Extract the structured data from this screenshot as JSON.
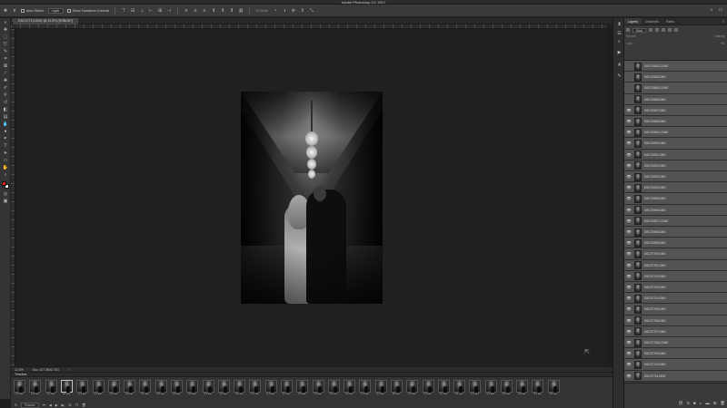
{
  "app": {
    "title": "Adobe Photoshop CC 2017"
  },
  "options_bar": {
    "auto_select_label": "Auto-Select:",
    "auto_select_value": "Layer",
    "transform_label": "Show Transform Controls",
    "mode_3d_label": "3D Mode:"
  },
  "document": {
    "tab_label": "DSC07713.DNG @ 12.5% (RGB/16*)",
    "close_glyph": "×"
  },
  "status": {
    "zoom": "12.5%",
    "doc_info": "Doc: 137.3M/2.74G"
  },
  "timeline": {
    "title": "Timeline",
    "loop": "Forever",
    "frames": [
      {
        "num": "1",
        "delay": "0.1 sec."
      },
      {
        "num": "2",
        "delay": "0.1 sec."
      },
      {
        "num": "3",
        "delay": "0.1 sec."
      },
      {
        "num": "4",
        "delay": "0.1 sec."
      },
      {
        "num": "5",
        "delay": "0.1 sec."
      },
      {
        "num": "6",
        "delay": "0.1 sec."
      },
      {
        "num": "7",
        "delay": "0.1 sec."
      },
      {
        "num": "8",
        "delay": "0.1 sec."
      },
      {
        "num": "9",
        "delay": "0.1 sec."
      },
      {
        "num": "10",
        "delay": "0.1 sec."
      },
      {
        "num": "11",
        "delay": "0.1 sec."
      },
      {
        "num": "12",
        "delay": "0.1 sec."
      },
      {
        "num": "13",
        "delay": "0.1 sec."
      },
      {
        "num": "14",
        "delay": "0.1 sec."
      },
      {
        "num": "15",
        "delay": "0.1 sec."
      },
      {
        "num": "16",
        "delay": "0.1 sec."
      },
      {
        "num": "17",
        "delay": "0.1 sec."
      },
      {
        "num": "18",
        "delay": "0.1 sec."
      },
      {
        "num": "19",
        "delay": "0.1 sec."
      },
      {
        "num": "20",
        "delay": "0.1 sec."
      },
      {
        "num": "21",
        "delay": "0.1 sec."
      },
      {
        "num": "22",
        "delay": "0.1 sec."
      },
      {
        "num": "23",
        "delay": "0.1 sec."
      },
      {
        "num": "24",
        "delay": "0.1 sec."
      },
      {
        "num": "25",
        "delay": "0.1 sec."
      },
      {
        "num": "26",
        "delay": "0.1 sec."
      },
      {
        "num": "27",
        "delay": "0.1 sec."
      },
      {
        "num": "28",
        "delay": "0.1 sec."
      },
      {
        "num": "29",
        "delay": "0.1 sec."
      },
      {
        "num": "30",
        "delay": "0.1 sec."
      },
      {
        "num": "31",
        "delay": "0.1 sec."
      },
      {
        "num": "32",
        "delay": "0.1 sec."
      },
      {
        "num": "33",
        "delay": "0.1 sec."
      },
      {
        "num": "34",
        "delay": "0.1 sec."
      },
      {
        "num": "35",
        "delay": "0.1 sec."
      }
    ]
  },
  "layers_panel": {
    "tabs": [
      "Layers",
      "Channels",
      "Paths"
    ],
    "filter_kind": "Kind",
    "blend_mode": "Normal",
    "opacity_label": "Opacity:",
    "lock_label": "Lock:",
    "fill_label": "Fill:",
    "layers": [
      "DSC07683-2.DNG",
      "DSC07684.DNG",
      "DSC07685-2.DNG",
      "DSC07686.DNG",
      "DSC07687.DNG",
      "DSC07688.DNG",
      "DSC07689-2.DNG",
      "DSC07690.DNG",
      "DSC07691.DNG",
      "DSC07692.DNG",
      "DSC07693.DNG",
      "DSC07694.DNG",
      "DSC07695.DNG",
      "DSC07696.DNG",
      "DSC07697-2.DNG",
      "DSC07698.DNG",
      "DSC07699.DNG",
      "DSC07700.DNG",
      "DSC07701.DNG",
      "DSC07702.DNG",
      "DSC07703.DNG",
      "DSC07704.DNG",
      "DSC07705.DNG",
      "DSC07706.DNG",
      "DSC07707.DNG",
      "DSC07708-2.DNG",
      "DSC07709.DNG",
      "DSC07710.DNG",
      "DSC07711.DNG"
    ]
  },
  "colors": {
    "foreground": "#e21b1b",
    "background": "#ffffff",
    "accent": "#535353"
  }
}
